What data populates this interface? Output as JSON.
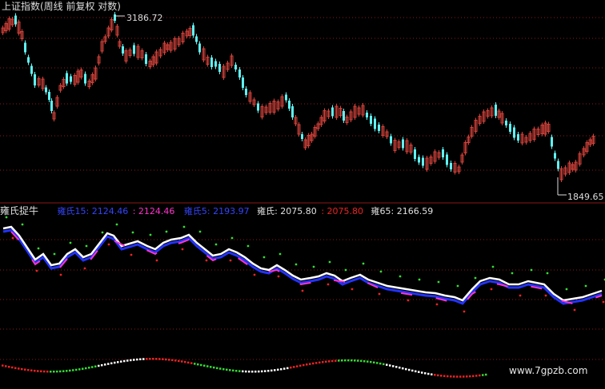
{
  "top_panel": {
    "title": "上证指数(周线 前复权 对数)",
    "high_label": "3186.72",
    "low_label": "1849.65"
  },
  "indicator_panel": {
    "name": "雍氏捉牛",
    "line1_label": "雍氏15: 2124.46",
    "line2_label": ": 2124.46",
    "line3_label": "雍氏5: 2193.97",
    "line4_label": "雍氏: 2075.80",
    "line5_label": ": 2075.80",
    "line6_label": "雍65: 2166.59"
  },
  "watermark": "www.7gpzb.com",
  "colors": {
    "up": "#d2423a",
    "down": "#5ff2f2",
    "white_line": "#ffffff",
    "blue_line": "#2233ff",
    "magenta_line": "#ff33cc",
    "green_dots": "#33dd33",
    "red_dots": "#ee2222",
    "grid": "#8b1a1a"
  }
}
